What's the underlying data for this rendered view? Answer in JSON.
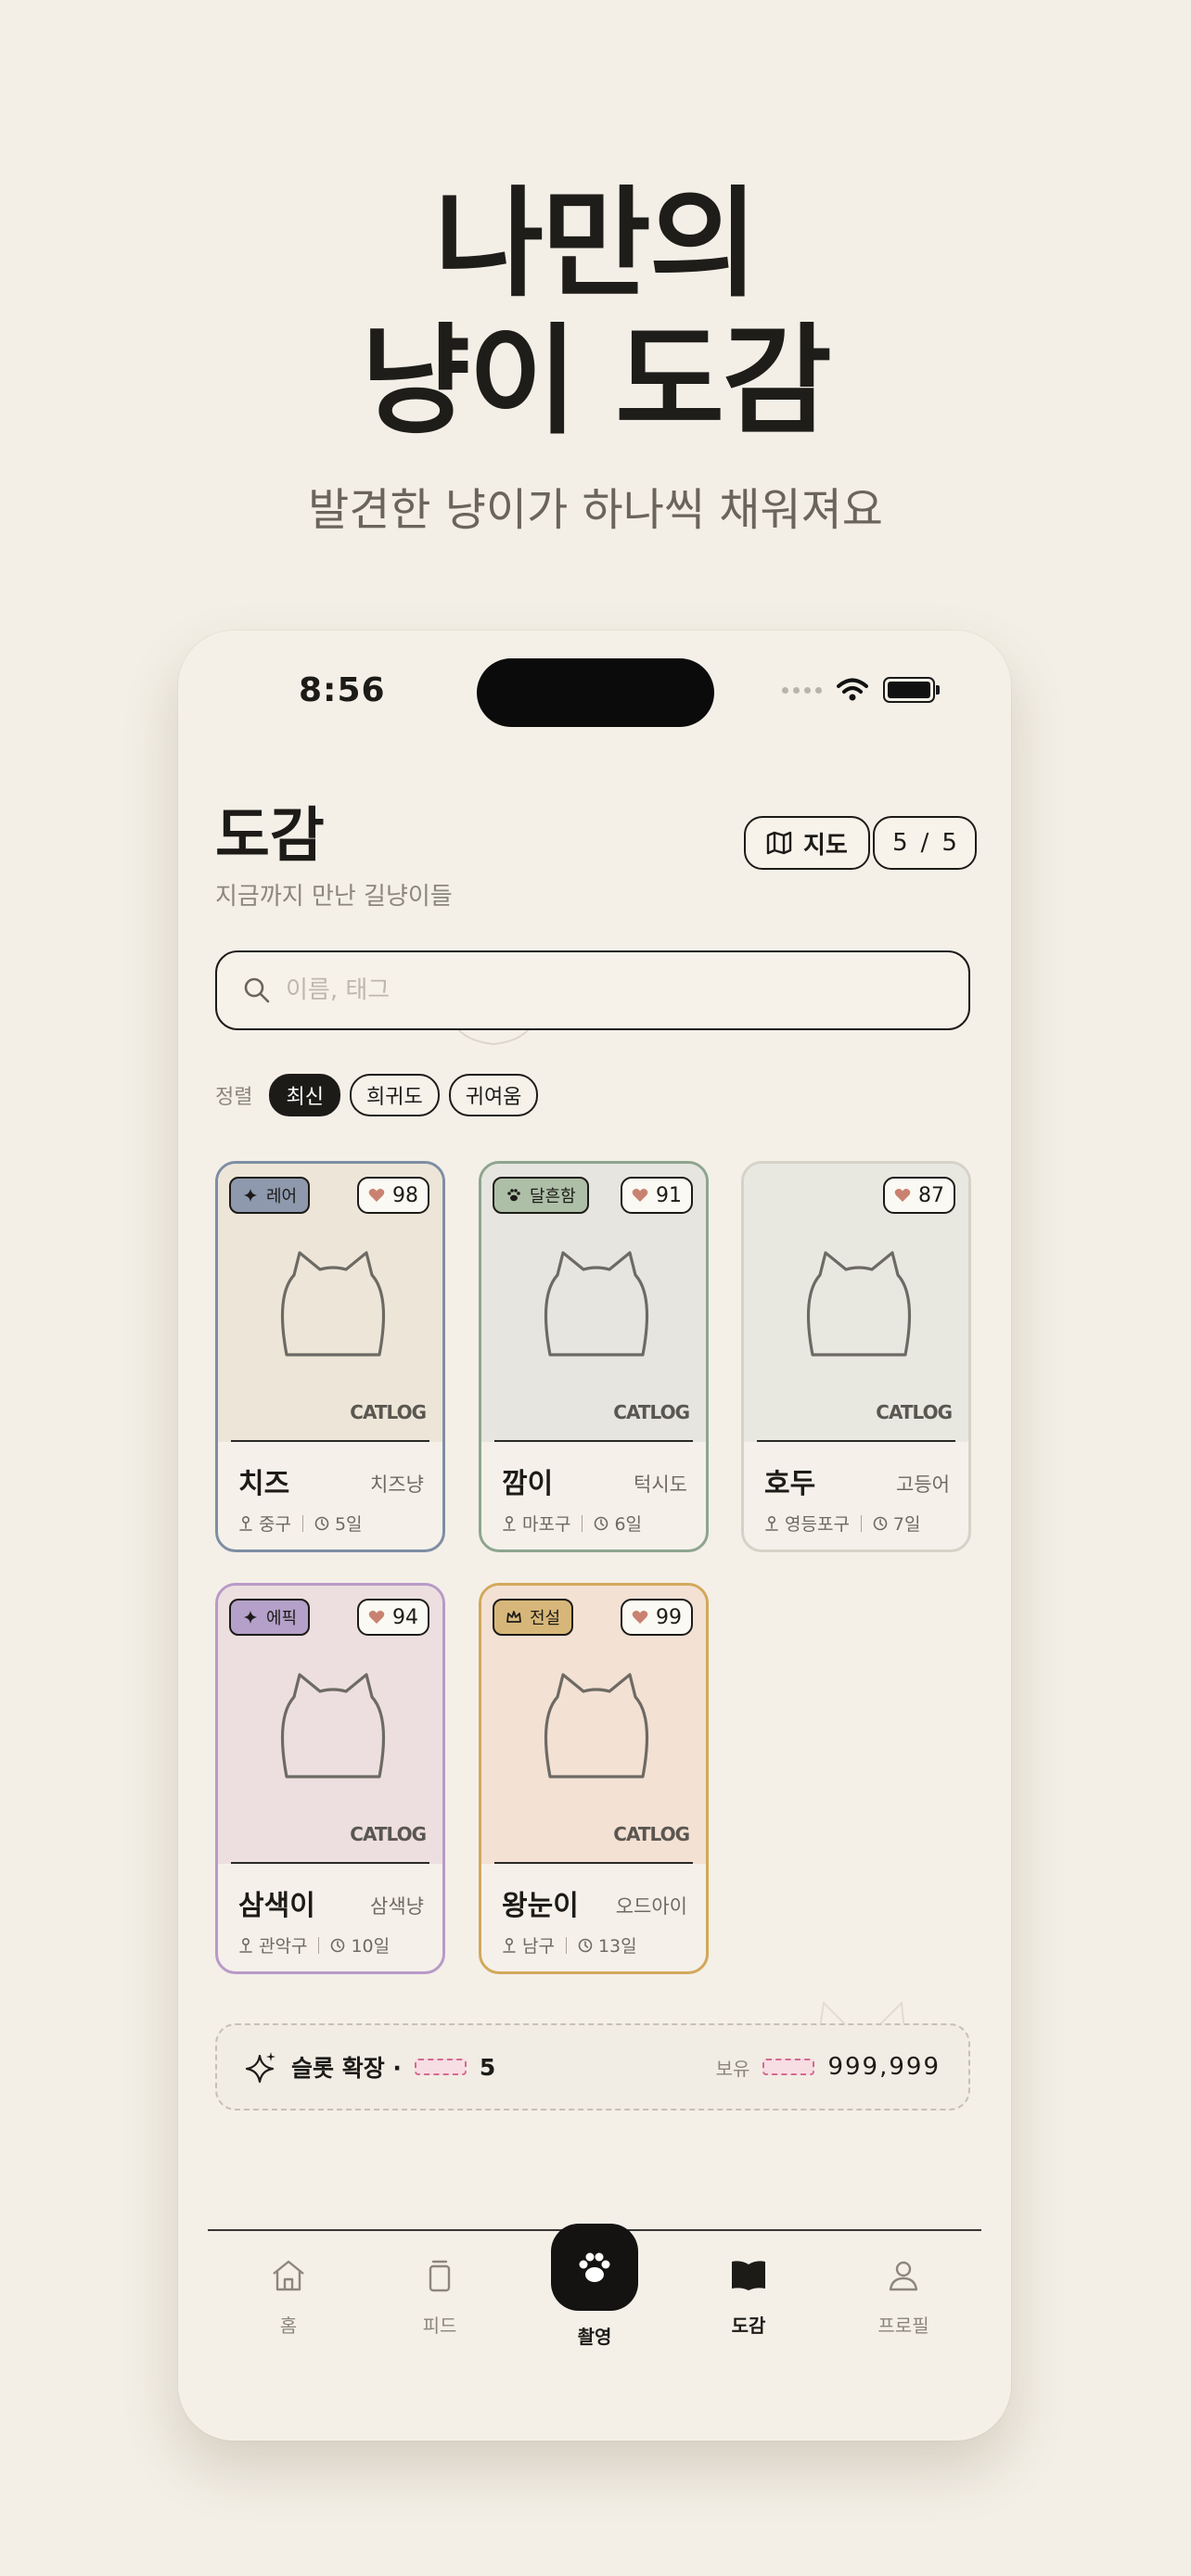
{
  "hero": {
    "line1": "나만의",
    "line2": "냥이 도감",
    "subtitle": "발견한 냥이가 하나씩 채워져요"
  },
  "status": {
    "time": "8:56"
  },
  "header": {
    "title": "도감",
    "subtitle": "지금까지 만난 길냥이들",
    "map_label": "지도",
    "count_current": "5",
    "count_sep": "/",
    "count_total": "5"
  },
  "search": {
    "placeholder": "이름, 태그"
  },
  "sort": {
    "label": "정렬",
    "options": [
      "최신",
      "희귀도",
      "귀여움"
    ],
    "selected": "최신"
  },
  "cards": [
    {
      "rarity": "레어",
      "rarity_icon": "sparkle-icon",
      "likes": "98",
      "name": "치즈",
      "breed": "치즈냥",
      "district": "중구",
      "days": "5일",
      "frame_color": "#7e8ea3",
      "art_color": "#ede6d8",
      "badge_color": "#8e99ad",
      "logo": "CATLOG"
    },
    {
      "rarity": "달흔함",
      "rarity_icon": "paw-icon",
      "likes": "91",
      "name": "깜이",
      "breed": "턱시도",
      "district": "마포구",
      "days": "6일",
      "frame_color": "#8ea58e",
      "art_color": "#e6e5e0",
      "badge_color": "#aebfa7",
      "logo": "CATLOG"
    },
    {
      "rarity": "",
      "rarity_icon": "",
      "likes": "87",
      "name": "호두",
      "breed": "고등어",
      "district": "영등포구",
      "days": "7일",
      "frame_color": "#d6d2c8",
      "art_color": "#e8e8e1",
      "badge_color": "",
      "logo": "CATLOG"
    },
    {
      "rarity": "에픽",
      "rarity_icon": "sparkle-icon",
      "likes": "94",
      "name": "삼색이",
      "breed": "삼색냥",
      "district": "관악구",
      "days": "10일",
      "frame_color": "#b99ac7",
      "art_color": "#eddfe0",
      "badge_color": "#b4a0c8",
      "logo": "CATLOG"
    },
    {
      "rarity": "전설",
      "rarity_icon": "crown-icon",
      "likes": "99",
      "name": "왕눈이",
      "breed": "오드아이",
      "district": "남구",
      "days": "13일",
      "frame_color": "#d2a85a",
      "art_color": "#f3e1d4",
      "badge_color": "#d7b779",
      "logo": "CATLOG"
    }
  ],
  "slot": {
    "label": "슬롯 확장 ·",
    "cost": "5",
    "own_label": "보유",
    "own_value": "999,999"
  },
  "tabs": [
    {
      "label": "홈",
      "icon": "home-icon"
    },
    {
      "label": "피드",
      "icon": "feed-icon"
    },
    {
      "label": "촬영",
      "icon": "paw-icon"
    },
    {
      "label": "도감",
      "icon": "book-icon"
    },
    {
      "label": "프로필",
      "icon": "profile-icon"
    }
  ],
  "colors": {
    "background": "#f3efe6",
    "ink": "#1d1b18",
    "heart": "#c98271"
  }
}
